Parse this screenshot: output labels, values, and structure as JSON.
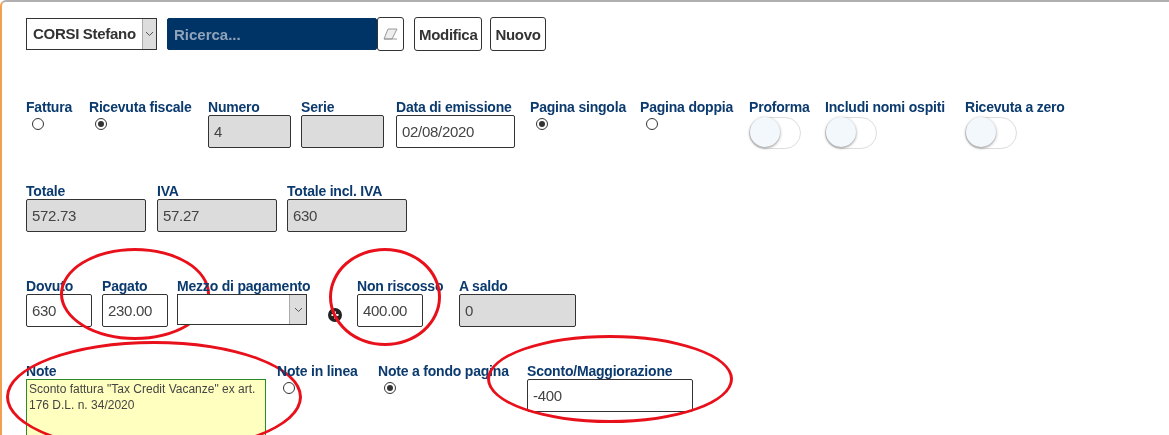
{
  "toolbar": {
    "user_select": "CORSI Stefano",
    "search": {
      "placeholder": "Ricerca..."
    },
    "buttons": [
      "Modifica",
      "Nuovo"
    ]
  },
  "rows": [
    [
      {
        "kind": "radio",
        "label": "Fattura",
        "selected": false
      },
      {
        "kind": "radio",
        "label": "Ricevuta fiscale",
        "selected": true
      },
      {
        "kind": "input",
        "label": "Numero",
        "value": "4",
        "disabled": true
      },
      {
        "kind": "input",
        "label": "Serie",
        "disabled": true
      },
      {
        "kind": "input",
        "label": "Data di emissione",
        "value": "02/08/2020",
        "disabled": false
      },
      {
        "kind": "radio",
        "label": "Pagina singola",
        "selected": true
      },
      {
        "kind": "radio",
        "label": "Pagina doppia",
        "selected": false
      },
      {
        "kind": "toggle",
        "label": "Proforma",
        "on": false
      },
      {
        "kind": "toggle",
        "label": "Includi nomi ospiti",
        "on": false
      },
      {
        "kind": "toggle",
        "label": "Ricevuta a zero",
        "on": false
      }
    ],
    [
      {
        "kind": "input",
        "label": "Totale",
        "value": "572.73",
        "disabled": true
      },
      {
        "kind": "input",
        "label": "IVA",
        "value": "57.27",
        "disabled": true
      },
      {
        "kind": "input",
        "label": "Totale incl. IVA",
        "value": "630",
        "disabled": true
      }
    ],
    [
      {
        "kind": "input",
        "label": "Dovuto",
        "value": "630",
        "disabled": false
      },
      {
        "kind": "input",
        "label": "Pagato",
        "value": "230.00",
        "disabled": false,
        "circled": true
      },
      {
        "kind": "select",
        "label": "Mezzo di pagamento"
      },
      {
        "kind": "add"
      },
      {
        "kind": "input",
        "label": "Non riscosso",
        "value": "400.00",
        "disabled": false,
        "circled": true
      },
      {
        "kind": "input",
        "label": "A saldo",
        "value": "0",
        "disabled": true
      }
    ],
    [
      {
        "kind": "textarea",
        "label": "Note",
        "value": "Sconto fattura \"Tax Credit Vacanze\" ex art. 176 D.L. n. 34/2020",
        "circled": true
      },
      {
        "kind": "radio",
        "label": "Note in linea",
        "selected": false
      },
      {
        "kind": "radio",
        "label": "Note a fondo pagina",
        "selected": true
      },
      {
        "kind": "input",
        "label": "Sconto/Maggiorazione",
        "value": "-400",
        "disabled": false,
        "circled": true
      }
    ]
  ]
}
